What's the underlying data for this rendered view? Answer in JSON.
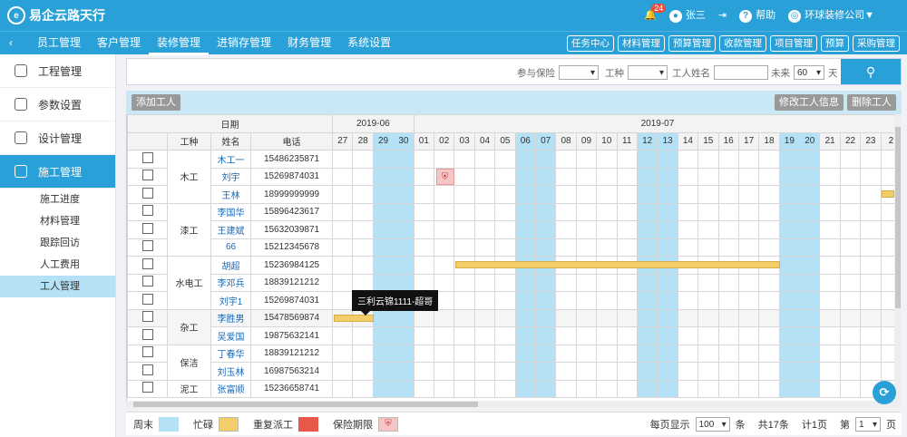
{
  "header": {
    "logo_text": "易企云路天行",
    "notif_count": "24",
    "user": "张三",
    "help": "帮助",
    "company": "环球装修公司▼"
  },
  "nav": {
    "back": "‹",
    "tabs": [
      "员工管理",
      "客户管理",
      "装修管理",
      "进销存管理",
      "财务管理",
      "系统设置"
    ],
    "active_tab": "装修管理",
    "quick": [
      "任务中心",
      "材料管理",
      "预算管理",
      "收款管理",
      "项目管理",
      "预算",
      "采购管理"
    ]
  },
  "sidebar": {
    "items": [
      {
        "label": "工程管理",
        "icon": "layers-icon"
      },
      {
        "label": "参数设置",
        "icon": "list-icon"
      },
      {
        "label": "设计管理",
        "icon": "design-icon"
      },
      {
        "label": "施工管理",
        "icon": "build-icon"
      }
    ],
    "subitems": [
      "施工进度",
      "材料管理",
      "跟踪回访",
      "人工费用",
      "工人管理"
    ],
    "active_sub": "工人管理"
  },
  "filter": {
    "insurance_label": "参与保险",
    "insurance_value": "",
    "trade_label": "工种",
    "trade_value": "",
    "worker_label": "工人姓名",
    "worker_value": "",
    "future_label": "未来",
    "days_value": "60",
    "days_unit": "天",
    "search_icon": "search-icon"
  },
  "toolbar": {
    "add": "添加工人",
    "edit": "修改工人信息",
    "delete": "删除工人"
  },
  "table": {
    "date_header": "日期",
    "trade_header": "工种",
    "name_header": "姓名",
    "phone_header": "电话",
    "month1": "2019-06",
    "month2": "2019-07",
    "days": [
      "27",
      "28",
      "29",
      "30",
      "01",
      "02",
      "03",
      "04",
      "05",
      "06",
      "07",
      "08",
      "09",
      "10",
      "11",
      "12",
      "13",
      "14",
      "15",
      "16",
      "17",
      "18",
      "19",
      "20",
      "21",
      "22",
      "23",
      "2"
    ],
    "weekend_cols": [
      2,
      3,
      9,
      10,
      15,
      16,
      22,
      23
    ],
    "groups": [
      {
        "trade": "木工",
        "rows": [
          {
            "name": "木工一",
            "phone": "15486235871"
          },
          {
            "name": "刘宇",
            "phone": "15269874031"
          },
          {
            "name": "王林",
            "phone": "18999999999"
          }
        ]
      },
      {
        "trade": "漆工",
        "rows": [
          {
            "name": "李国华",
            "phone": "15896423617"
          },
          {
            "name": "王建斌",
            "phone": "15632039871"
          },
          {
            "name": "66",
            "phone": "15212345678"
          }
        ]
      },
      {
        "trade": "水电工",
        "rows": [
          {
            "name": "胡超",
            "phone": "15236984125"
          },
          {
            "name": "李邓兵",
            "phone": "18839121212"
          },
          {
            "name": "刘宇1",
            "phone": "15269874031"
          }
        ]
      },
      {
        "trade": "杂工",
        "rows": [
          {
            "name": "李胜男",
            "phone": "15478569874"
          },
          {
            "name": "吴爱国",
            "phone": "19875632141"
          }
        ]
      },
      {
        "trade": "保洁",
        "rows": [
          {
            "name": "丁春华",
            "phone": "18839121212"
          },
          {
            "name": "刘玉林",
            "phone": "16987563214"
          }
        ]
      },
      {
        "trade": "泥工",
        "rows": [
          {
            "name": "张富顺",
            "phone": "15236658741"
          }
        ]
      }
    ]
  },
  "tooltip": "三利云锦1111-超哥",
  "legend": {
    "weekend": "周末",
    "busy": "忙碌",
    "duplicate": "重复派工",
    "insurance": "保险期限"
  },
  "colors": {
    "weekend": "#b5e1f7",
    "busy": "#f2cd6a",
    "duplicate": "#e8584a",
    "insurance": "#f6c6c6",
    "brand": "#2aa0d8"
  },
  "pager": {
    "per_page_label": "每页显示",
    "per_page": "100",
    "unit": "条",
    "total": "共17条",
    "pages": "计1页",
    "page_label": "第",
    "page": "1",
    "page_unit": "页"
  }
}
